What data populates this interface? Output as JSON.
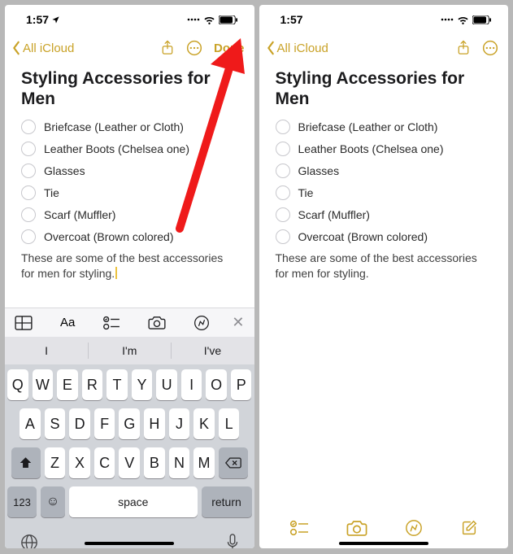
{
  "status": {
    "time": "1:57"
  },
  "nav": {
    "back": "All iCloud",
    "done": "Done"
  },
  "note": {
    "title": "Styling Accessories for Men",
    "items": [
      "Briefcase (Leather or Cloth)",
      "Leather Boots (Chelsea one)",
      "Glasses",
      "Tie",
      "Scarf (Muffler)",
      "Overcoat (Brown colored)"
    ],
    "paragraph": "These are some of the best accessories for men for styling."
  },
  "predict": {
    "p0": "I",
    "p1": "I'm",
    "p2": "I've"
  },
  "keys": {
    "r1": [
      "Q",
      "W",
      "E",
      "R",
      "T",
      "Y",
      "U",
      "I",
      "O",
      "P"
    ],
    "r2": [
      "A",
      "S",
      "D",
      "F",
      "G",
      "H",
      "J",
      "K",
      "L"
    ],
    "r3": [
      "Z",
      "X",
      "C",
      "V",
      "B",
      "N",
      "M"
    ],
    "k123": "123",
    "space": "space",
    "return": "return"
  },
  "colors": {
    "accent": "#c9a227",
    "arrow": "#ef1a1a"
  }
}
